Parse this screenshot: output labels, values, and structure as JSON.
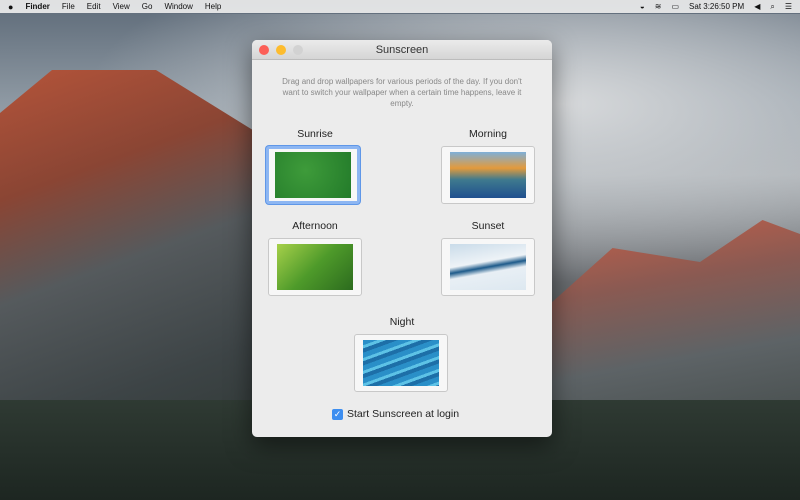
{
  "menubar": {
    "apple": "",
    "app": "Finder",
    "items": [
      "File",
      "Edit",
      "View",
      "Go",
      "Window",
      "Help"
    ],
    "clock": "Sat 3:26:50 PM",
    "status_icons": [
      "notification-icon",
      "wifi-icon",
      "battery-icon",
      "volume-icon",
      "spotlight-icon",
      "list-icon"
    ]
  },
  "window": {
    "title": "Sunscreen",
    "description": "Drag and drop wallpapers for various periods of the day. If you don't want to switch your wallpaper when a certain time happens, leave it empty.",
    "slots": [
      {
        "label": "Sunrise"
      },
      {
        "label": "Morning"
      },
      {
        "label": "Afternoon"
      },
      {
        "label": "Sunset"
      },
      {
        "label": "Night"
      }
    ],
    "checkbox": {
      "label": "Start Sunscreen at login",
      "checked": true
    }
  },
  "colors": {
    "accent": "#3d8ef0"
  }
}
